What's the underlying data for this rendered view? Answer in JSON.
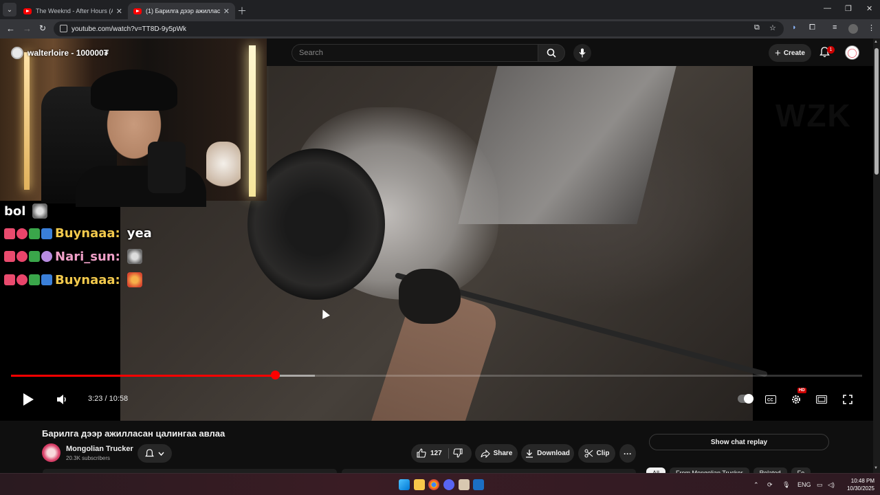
{
  "browser": {
    "tabs": [
      {
        "label": "The Weeknd - After Hours (Aud",
        "active": false
      },
      {
        "label": "(1) Барилга дээр ажилласан ц",
        "active": true
      }
    ],
    "url": "youtube.com/watch?v=TT8D-9y5pWk"
  },
  "youtube": {
    "search_placeholder": "Search",
    "create_label": "Create",
    "notification_count": "1"
  },
  "overlay": {
    "streamer": "walterloire - 100000₮",
    "chat": [
      {
        "user": "bol",
        "message": ""
      },
      {
        "user": "Buynaaa:",
        "message": "yea"
      },
      {
        "user": "Nari_sun:",
        "message": ""
      },
      {
        "user": "Buynaaa:",
        "message": ""
      }
    ]
  },
  "player": {
    "current_time": "3:23",
    "duration": "10:58",
    "time_display": "3:23 / 10:58",
    "played_fraction": 0.31,
    "buffered_fraction": 0.357,
    "quality_badge": "HD"
  },
  "video": {
    "title": "Барилга дээр ажилласан цалингаа авлаа",
    "channel": "Mongolian Trucker",
    "subscribers": "20.3K subscribers",
    "likes": "127",
    "share_label": "Share",
    "download_label": "Download",
    "clip_label": "Clip",
    "more_label": "···"
  },
  "sidebar": {
    "chat_replay_label": "Show chat replay",
    "chips": [
      "All",
      "From Mongolian Trucker",
      "Related",
      "Fo"
    ]
  },
  "taskbar": {
    "lang": "ENG",
    "time": "10:48 PM",
    "date": "10/30/2025"
  },
  "colors": {
    "accent": "#ff0000",
    "bg": "#0f0f0f",
    "chip_bg": "#272727"
  }
}
